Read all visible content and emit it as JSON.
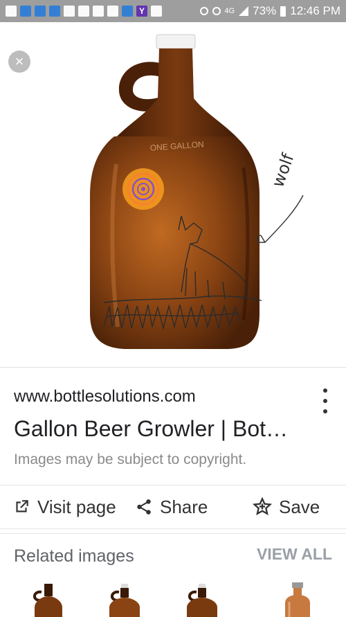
{
  "status_bar": {
    "battery": "73%",
    "time": "12:46 PM",
    "network": "4G"
  },
  "viewer": {
    "close_symbol": "×",
    "jug_embossing": "ONE GALLON",
    "annotation": "wolf"
  },
  "result": {
    "domain": "www.bottlesolutions.com",
    "title": "Gallon Beer Growler | Bot…",
    "copyright": "Images may be subject to copyright."
  },
  "actions": {
    "visit": "Visit page",
    "share": "Share",
    "save": "Save"
  },
  "related": {
    "title": "Related images",
    "view_all": "VIEW ALL"
  },
  "colors": {
    "amber": "#7a3c10",
    "status_bar": "#9e9e9e",
    "sun_orange": "#f39a1e",
    "sun_purple": "#8a4fc8"
  },
  "icons": [
    "close-icon",
    "open-external-icon",
    "share-icon",
    "star-add-icon",
    "more-vert-icon"
  ]
}
